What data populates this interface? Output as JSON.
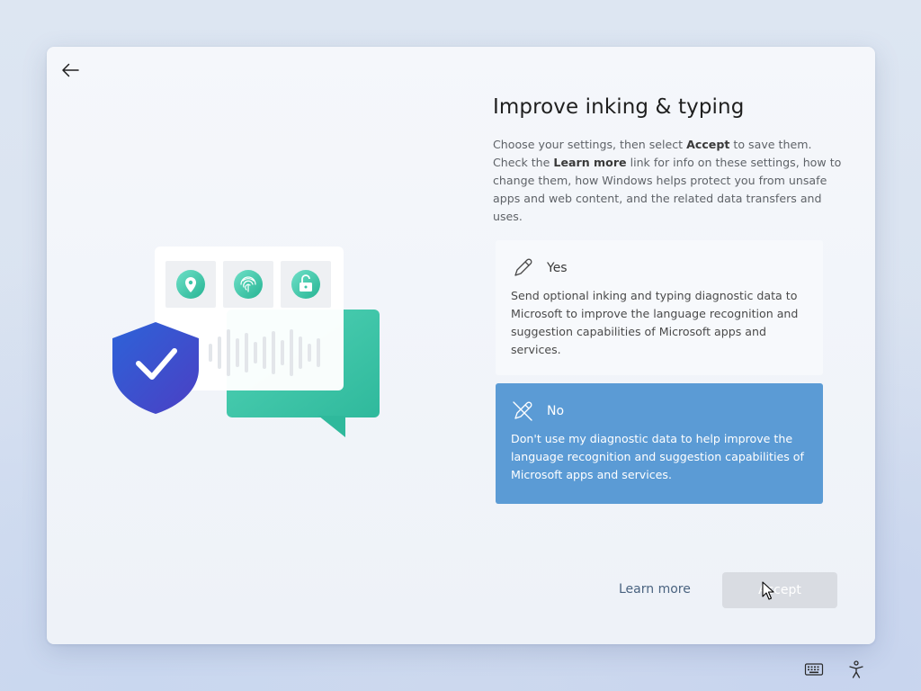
{
  "header": {
    "title": "Improve inking & typing",
    "description": {
      "part1": "Choose your settings, then select ",
      "accept_word": "Accept",
      "part2": " to save them. Check the ",
      "learn_more_word": "Learn more",
      "part3": " link for info on these settings, how to change them, how Windows helps protect you from unsafe apps and web content, and the related data transfers and uses."
    }
  },
  "options": [
    {
      "label": "Yes",
      "text": "Send optional inking and typing diagnostic data to Microsoft to improve the language recognition and suggestion capabilities of Microsoft apps and services.",
      "selected": false,
      "icon": "pen-icon"
    },
    {
      "label": "No",
      "text": "Don't use my diagnostic data to help improve the language recognition and suggestion capabilities of Microsoft apps and services.",
      "selected": true,
      "icon": "pen-off-icon"
    }
  ],
  "footer": {
    "learn_more": "Learn more",
    "accept": "Accept"
  },
  "colors": {
    "selected_option": "#5b9bd5",
    "shield": "#2f5fd0",
    "chat_bubble": "#3fc7aa"
  }
}
